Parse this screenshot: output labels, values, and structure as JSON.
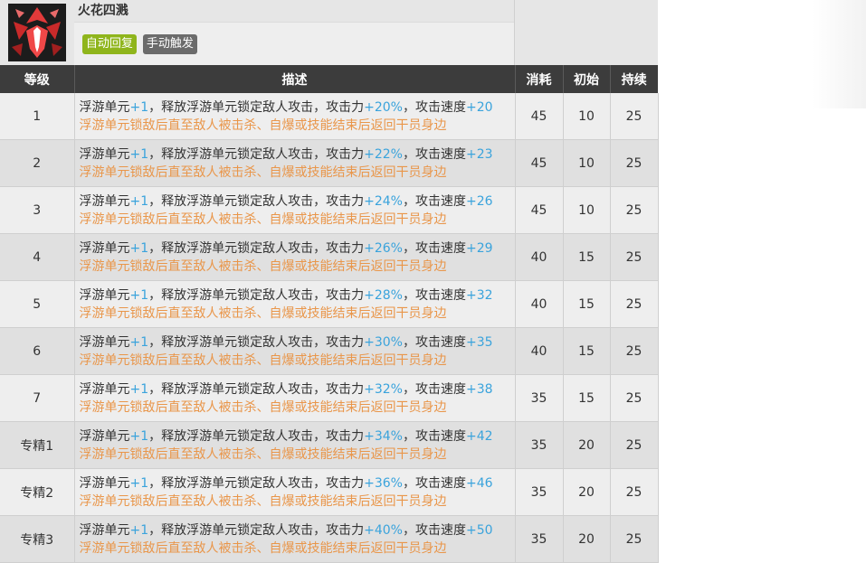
{
  "skill": {
    "name": "火花四溅",
    "tags": [
      "自动回复",
      "手动触发"
    ],
    "icon": "skill-icon"
  },
  "columns": [
    "等级",
    "描述",
    "消耗",
    "初始",
    "持续"
  ],
  "rows": [
    {
      "level": "1",
      "t1": "浮游单元",
      "v1": "+1",
      "t2": "，释放浮游单元锁定敌人攻击，攻击力",
      "atk": "+20%",
      "t3": "，攻击速度",
      "spd": "+20",
      "line2": "浮游单元锁敌后直至敌人被击杀、自爆或技能结束后返回干员身边",
      "cost": "45",
      "init": "10",
      "dur": "25"
    },
    {
      "level": "2",
      "t1": "浮游单元",
      "v1": "+1",
      "t2": "，释放浮游单元锁定敌人攻击，攻击力",
      "atk": "+22%",
      "t3": "，攻击速度",
      "spd": "+23",
      "line2": "浮游单元锁敌后直至敌人被击杀、自爆或技能结束后返回干员身边",
      "cost": "45",
      "init": "10",
      "dur": "25"
    },
    {
      "level": "3",
      "t1": "浮游单元",
      "v1": "+1",
      "t2": "，释放浮游单元锁定敌人攻击，攻击力",
      "atk": "+24%",
      "t3": "，攻击速度",
      "spd": "+26",
      "line2": "浮游单元锁敌后直至敌人被击杀、自爆或技能结束后返回干员身边",
      "cost": "45",
      "init": "10",
      "dur": "25"
    },
    {
      "level": "4",
      "t1": "浮游单元",
      "v1": "+1",
      "t2": "，释放浮游单元锁定敌人攻击，攻击力",
      "atk": "+26%",
      "t3": "，攻击速度",
      "spd": "+29",
      "line2": "浮游单元锁敌后直至敌人被击杀、自爆或技能结束后返回干员身边",
      "cost": "40",
      "init": "15",
      "dur": "25"
    },
    {
      "level": "5",
      "t1": "浮游单元",
      "v1": "+1",
      "t2": "，释放浮游单元锁定敌人攻击，攻击力",
      "atk": "+28%",
      "t3": "，攻击速度",
      "spd": "+32",
      "line2": "浮游单元锁敌后直至敌人被击杀、自爆或技能结束后返回干员身边",
      "cost": "40",
      "init": "15",
      "dur": "25"
    },
    {
      "level": "6",
      "t1": "浮游单元",
      "v1": "+1",
      "t2": "，释放浮游单元锁定敌人攻击，攻击力",
      "atk": "+30%",
      "t3": "，攻击速度",
      "spd": "+35",
      "line2": "浮游单元锁敌后直至敌人被击杀、自爆或技能结束后返回干员身边",
      "cost": "40",
      "init": "15",
      "dur": "25"
    },
    {
      "level": "7",
      "t1": "浮游单元",
      "v1": "+1",
      "t2": "，释放浮游单元锁定敌人攻击，攻击力",
      "atk": "+32%",
      "t3": "，攻击速度",
      "spd": "+38",
      "line2": "浮游单元锁敌后直至敌人被击杀、自爆或技能结束后返回干员身边",
      "cost": "35",
      "init": "15",
      "dur": "25"
    },
    {
      "level": "专精1",
      "t1": "浮游单元",
      "v1": "+1",
      "t2": "，释放浮游单元锁定敌人攻击，攻击力",
      "atk": "+34%",
      "t3": "，攻击速度",
      "spd": "+42",
      "line2": "浮游单元锁敌后直至敌人被击杀、自爆或技能结束后返回干员身边",
      "cost": "35",
      "init": "20",
      "dur": "25"
    },
    {
      "level": "专精2",
      "t1": "浮游单元",
      "v1": "+1",
      "t2": "，释放浮游单元锁定敌人攻击，攻击力",
      "atk": "+36%",
      "t3": "，攻击速度",
      "spd": "+46",
      "line2": "浮游单元锁敌后直至敌人被击杀、自爆或技能结束后返回干员身边",
      "cost": "35",
      "init": "20",
      "dur": "25"
    },
    {
      "level": "专精3",
      "t1": "浮游单元",
      "v1": "+1",
      "t2": "，释放浮游单元锁定敌人攻击，攻击力",
      "atk": "+40%",
      "t3": "，攻击速度",
      "spd": "+50",
      "line2": "浮游单元锁敌后直至敌人被击杀、自爆或技能结束后返回干员身边",
      "cost": "35",
      "init": "20",
      "dur": "25"
    }
  ],
  "colors": {
    "header_bg": "#3c3c3c",
    "tag_green": "#8fb51c",
    "tag_gray": "#6b6b6b",
    "value_blue": "#3aa3dc",
    "note_orange": "#e9964a"
  }
}
